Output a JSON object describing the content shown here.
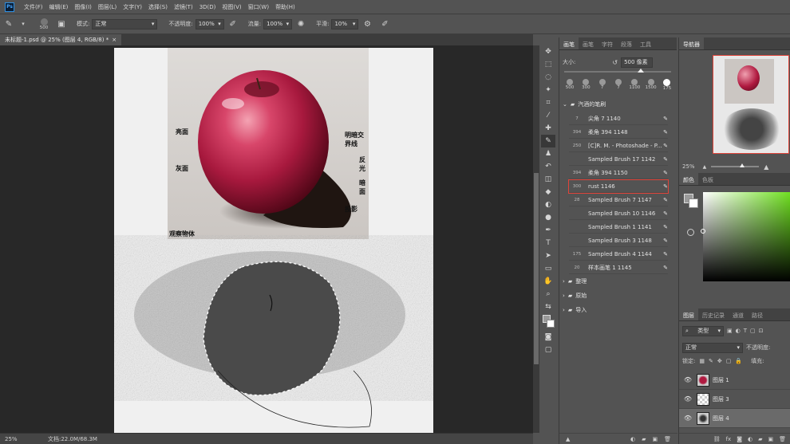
{
  "app": {
    "logo": "Ps"
  },
  "menu": [
    "文件(F)",
    "编辑(E)",
    "图像(I)",
    "图层(L)",
    "文字(Y)",
    "选择(S)",
    "滤镜(T)",
    "3D(D)",
    "视图(V)",
    "窗口(W)",
    "帮助(H)"
  ],
  "options": {
    "brush_size": "500",
    "mode_label": "模式:",
    "mode_value": "正常",
    "opacity_label": "不透明度:",
    "opacity_value": "100%",
    "flow_label": "流量:",
    "flow_value": "100%",
    "smooth_label": "平滑:",
    "smooth_value": "10%"
  },
  "doc_tab": {
    "title": "未标题-1.psd @ 25% (图层 4, RGB/8) *",
    "close": "×"
  },
  "reference": {
    "labels": {
      "highlight": "亮面",
      "gray": "灰面",
      "terminator": "明暗交界线",
      "reflected": "反光",
      "dark": "暗面",
      "cast_shadow": "投影",
      "caption": "观察物体"
    }
  },
  "status": {
    "zoom": "25%",
    "doc_info": "文档:22.0M/68.3M"
  },
  "brush_panel": {
    "tabs": [
      "画笔",
      "画笔",
      "字符",
      "段落",
      "工具"
    ],
    "size_label": "大小:",
    "size_value": "500 像素",
    "presets": [
      "500",
      "300",
      "7",
      "7",
      "1100",
      "1500",
      "175"
    ],
    "folder_open": "汽酒的笔刷",
    "brushes": [
      {
        "num": "7",
        "name": "尖角 7 1140"
      },
      {
        "num": "394",
        "name": "柔角 394 1148"
      },
      {
        "num": "250",
        "name": "[C]R. M. - Photoshade - P..."
      },
      {
        "num": "",
        "name": "Sampled Brush 17 1142"
      },
      {
        "num": "394",
        "name": "柔角 394 1150"
      },
      {
        "num": "300",
        "name": "rust 1146"
      },
      {
        "num": "28",
        "name": "Sampled Brush 7 1147"
      },
      {
        "num": "",
        "name": "Sampled Brush 10 1146"
      },
      {
        "num": "",
        "name": "Sampled Brush 1 1141"
      },
      {
        "num": "",
        "name": "Sampled Brush 3 1148"
      },
      {
        "num": "175",
        "name": "Sampled Brush 4 1144"
      },
      {
        "num": "20",
        "name": "样本画笔 1 1145"
      }
    ],
    "folders": [
      "整理",
      "原始",
      "导入"
    ]
  },
  "navigator": {
    "tabs": [
      "导航器"
    ],
    "zoom": "25%"
  },
  "color_panel": {
    "tabs": [
      "颜色",
      "色板"
    ]
  },
  "layers_panel": {
    "tabs": [
      "图层",
      "历史记录",
      "通道",
      "路径"
    ],
    "filter": "类型",
    "blend": "正常",
    "opacity_label": "不透明度:",
    "fill_label": "填充:",
    "lock_label": "锁定:",
    "layers": [
      "图层 1",
      "图层 3",
      "图层 4"
    ]
  },
  "colors": {
    "accent_red": "#e0443a",
    "selection_frame": "#e0443a"
  }
}
